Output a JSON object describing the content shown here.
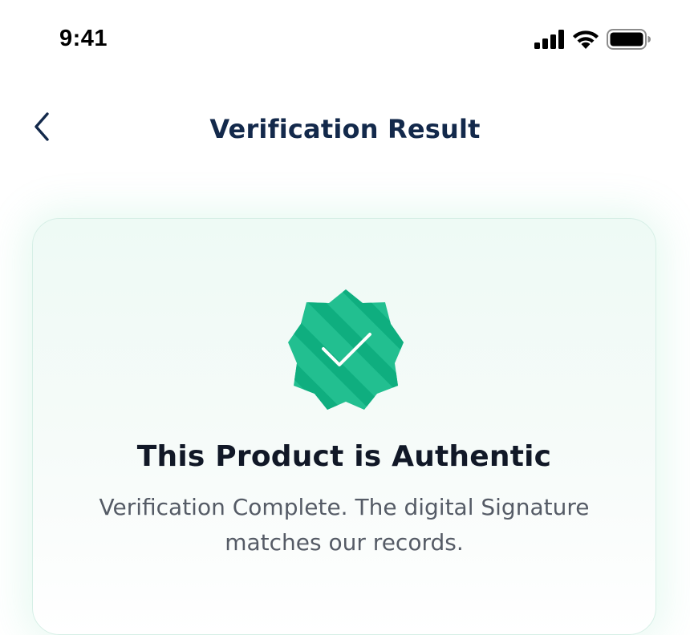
{
  "status_bar": {
    "time": "9:41",
    "icons": [
      "cellular-signal-icon",
      "wifi-icon",
      "battery-icon"
    ]
  },
  "nav": {
    "back_icon": "chevron-left-icon",
    "title": "Verification Result"
  },
  "result": {
    "badge_icon": "verified-badge-check-icon",
    "title": "This Product is Authentic",
    "message": "Verification Complete. The digital Signature matches our records."
  },
  "colors": {
    "accent": "#1dba8a",
    "accent_dark": "#0fa878",
    "title": "#13294b",
    "body_text": "#555b66",
    "card_bg": "#eefaf5"
  }
}
